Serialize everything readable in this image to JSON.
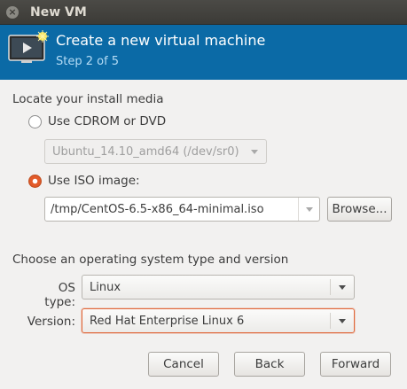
{
  "window": {
    "title": "New VM",
    "close_glyph": "×"
  },
  "header": {
    "title": "Create a new virtual machine",
    "step": "Step 2 of 5",
    "icon": "vm-monitor-icon"
  },
  "install_media": {
    "section_label": "Locate your install media",
    "cdrom": {
      "label": "Use CDROM or DVD",
      "selected": false,
      "device_value": "Ubuntu_14.10_amd64 (/dev/sr0)",
      "enabled": false
    },
    "iso": {
      "label": "Use ISO image:",
      "selected": true,
      "path_value": "/tmp/CentOS-6.5-x86_64-minimal.iso",
      "browse_label": "Browse..."
    }
  },
  "os": {
    "section_label": "Choose an operating system type and version",
    "type_label": "OS type:",
    "type_value": "Linux",
    "version_label": "Version:",
    "version_value": "Red Hat Enterprise Linux 6"
  },
  "buttons": {
    "cancel": "Cancel",
    "back": "Back",
    "forward": "Forward"
  },
  "colors": {
    "header_bg": "#0b6aa6",
    "accent_orange": "#e35b2a",
    "titlebar_bg": "#3c3b37"
  }
}
